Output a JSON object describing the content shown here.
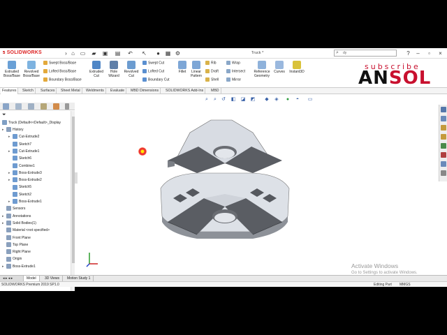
{
  "app": {
    "logo": "SOLIDWORKS",
    "document_title": "Truck *",
    "search_placeholder": "dy"
  },
  "watermark": {
    "subscribe": "subscribe",
    "brand_black": "AN",
    "brand_red": "SOL"
  },
  "commands": {
    "extruded_boss": "Extruded Boss/Base",
    "revolved_boss": "Revolved Boss/Base",
    "swept_boss": "Swept Boss/Base",
    "lofted_boss": "Lofted Boss/Base",
    "boundary_boss": "Boundary Boss/Base",
    "extruded_cut": "Extruded Cut",
    "hole_wizard": "Hole Wizard",
    "revolved_cut": "Revolved Cut",
    "swept_cut": "Swept Cut",
    "lofted_cut": "Lofted Cut",
    "boundary_cut": "Boundary Cut",
    "fillet": "Fillet",
    "linear_pattern": "Linear Pattern",
    "rib": "Rib",
    "draft": "Draft",
    "shell": "Shell",
    "wrap": "Wrap",
    "intersect": "Intersect",
    "mirror": "Mirror",
    "reference_geometry": "Reference Geometry",
    "curves": "Curves",
    "instant3d": "Instant3D"
  },
  "tabs": [
    "Features",
    "Sketch",
    "Surfaces",
    "Sheet Metal",
    "Weldments",
    "Evaluate",
    "MBD Dimensions",
    "SOLIDWORKS Add-Ins",
    "MBD"
  ],
  "tree": {
    "root": "Truck  (Default<<Default>_Display",
    "items": [
      {
        "label": "History",
        "indent": 1,
        "expander": "▸"
      },
      {
        "label": "Cut-Extrude2",
        "indent": 2,
        "expander": "▸"
      },
      {
        "label": "Sketch7",
        "indent": 2,
        "expander": ""
      },
      {
        "label": "Cut-Extrude1",
        "indent": 2,
        "expander": "▸"
      },
      {
        "label": "Sketch6",
        "indent": 2,
        "expander": ""
      },
      {
        "label": "Combine1",
        "indent": 2,
        "expander": ""
      },
      {
        "label": "Boss-Extrude3",
        "indent": 2,
        "expander": "▸"
      },
      {
        "label": "Boss-Extrude2",
        "indent": 2,
        "expander": "▸"
      },
      {
        "label": "Sketch5",
        "indent": 2,
        "expander": ""
      },
      {
        "label": "Sketch2",
        "indent": 2,
        "expander": ""
      },
      {
        "label": "Boss-Extrude1",
        "indent": 2,
        "expander": "▸"
      },
      {
        "label": "Sensors",
        "indent": 1,
        "expander": ""
      },
      {
        "label": "Annotations",
        "indent": 1,
        "expander": "▸"
      },
      {
        "label": "Solid Bodies(1)",
        "indent": 1,
        "expander": "▸"
      },
      {
        "label": "Material <not specified>",
        "indent": 1,
        "expander": ""
      },
      {
        "label": "Front Plane",
        "indent": 1,
        "expander": ""
      },
      {
        "label": "Top Plane",
        "indent": 1,
        "expander": ""
      },
      {
        "label": "Right Plane",
        "indent": 1,
        "expander": ""
      },
      {
        "label": "Origin",
        "indent": 1,
        "expander": ""
      },
      {
        "label": "Boss-Extrude1",
        "indent": 1,
        "expander": "▸"
      }
    ]
  },
  "model_tabs": [
    "Model",
    "3D Views",
    "Motion Study 1"
  ],
  "status": {
    "product": "SOLIDWORKS Premium 2019 SP1.0",
    "mode": "Editing Part",
    "units": "MMGS"
  },
  "os_watermark": {
    "line1": "Activate Windows",
    "line2": "Go to Settings to activate Windows."
  },
  "colors": {
    "accent_red": "#c8102e",
    "part_face": "#d9dde4",
    "part_dark": "#54575d"
  }
}
